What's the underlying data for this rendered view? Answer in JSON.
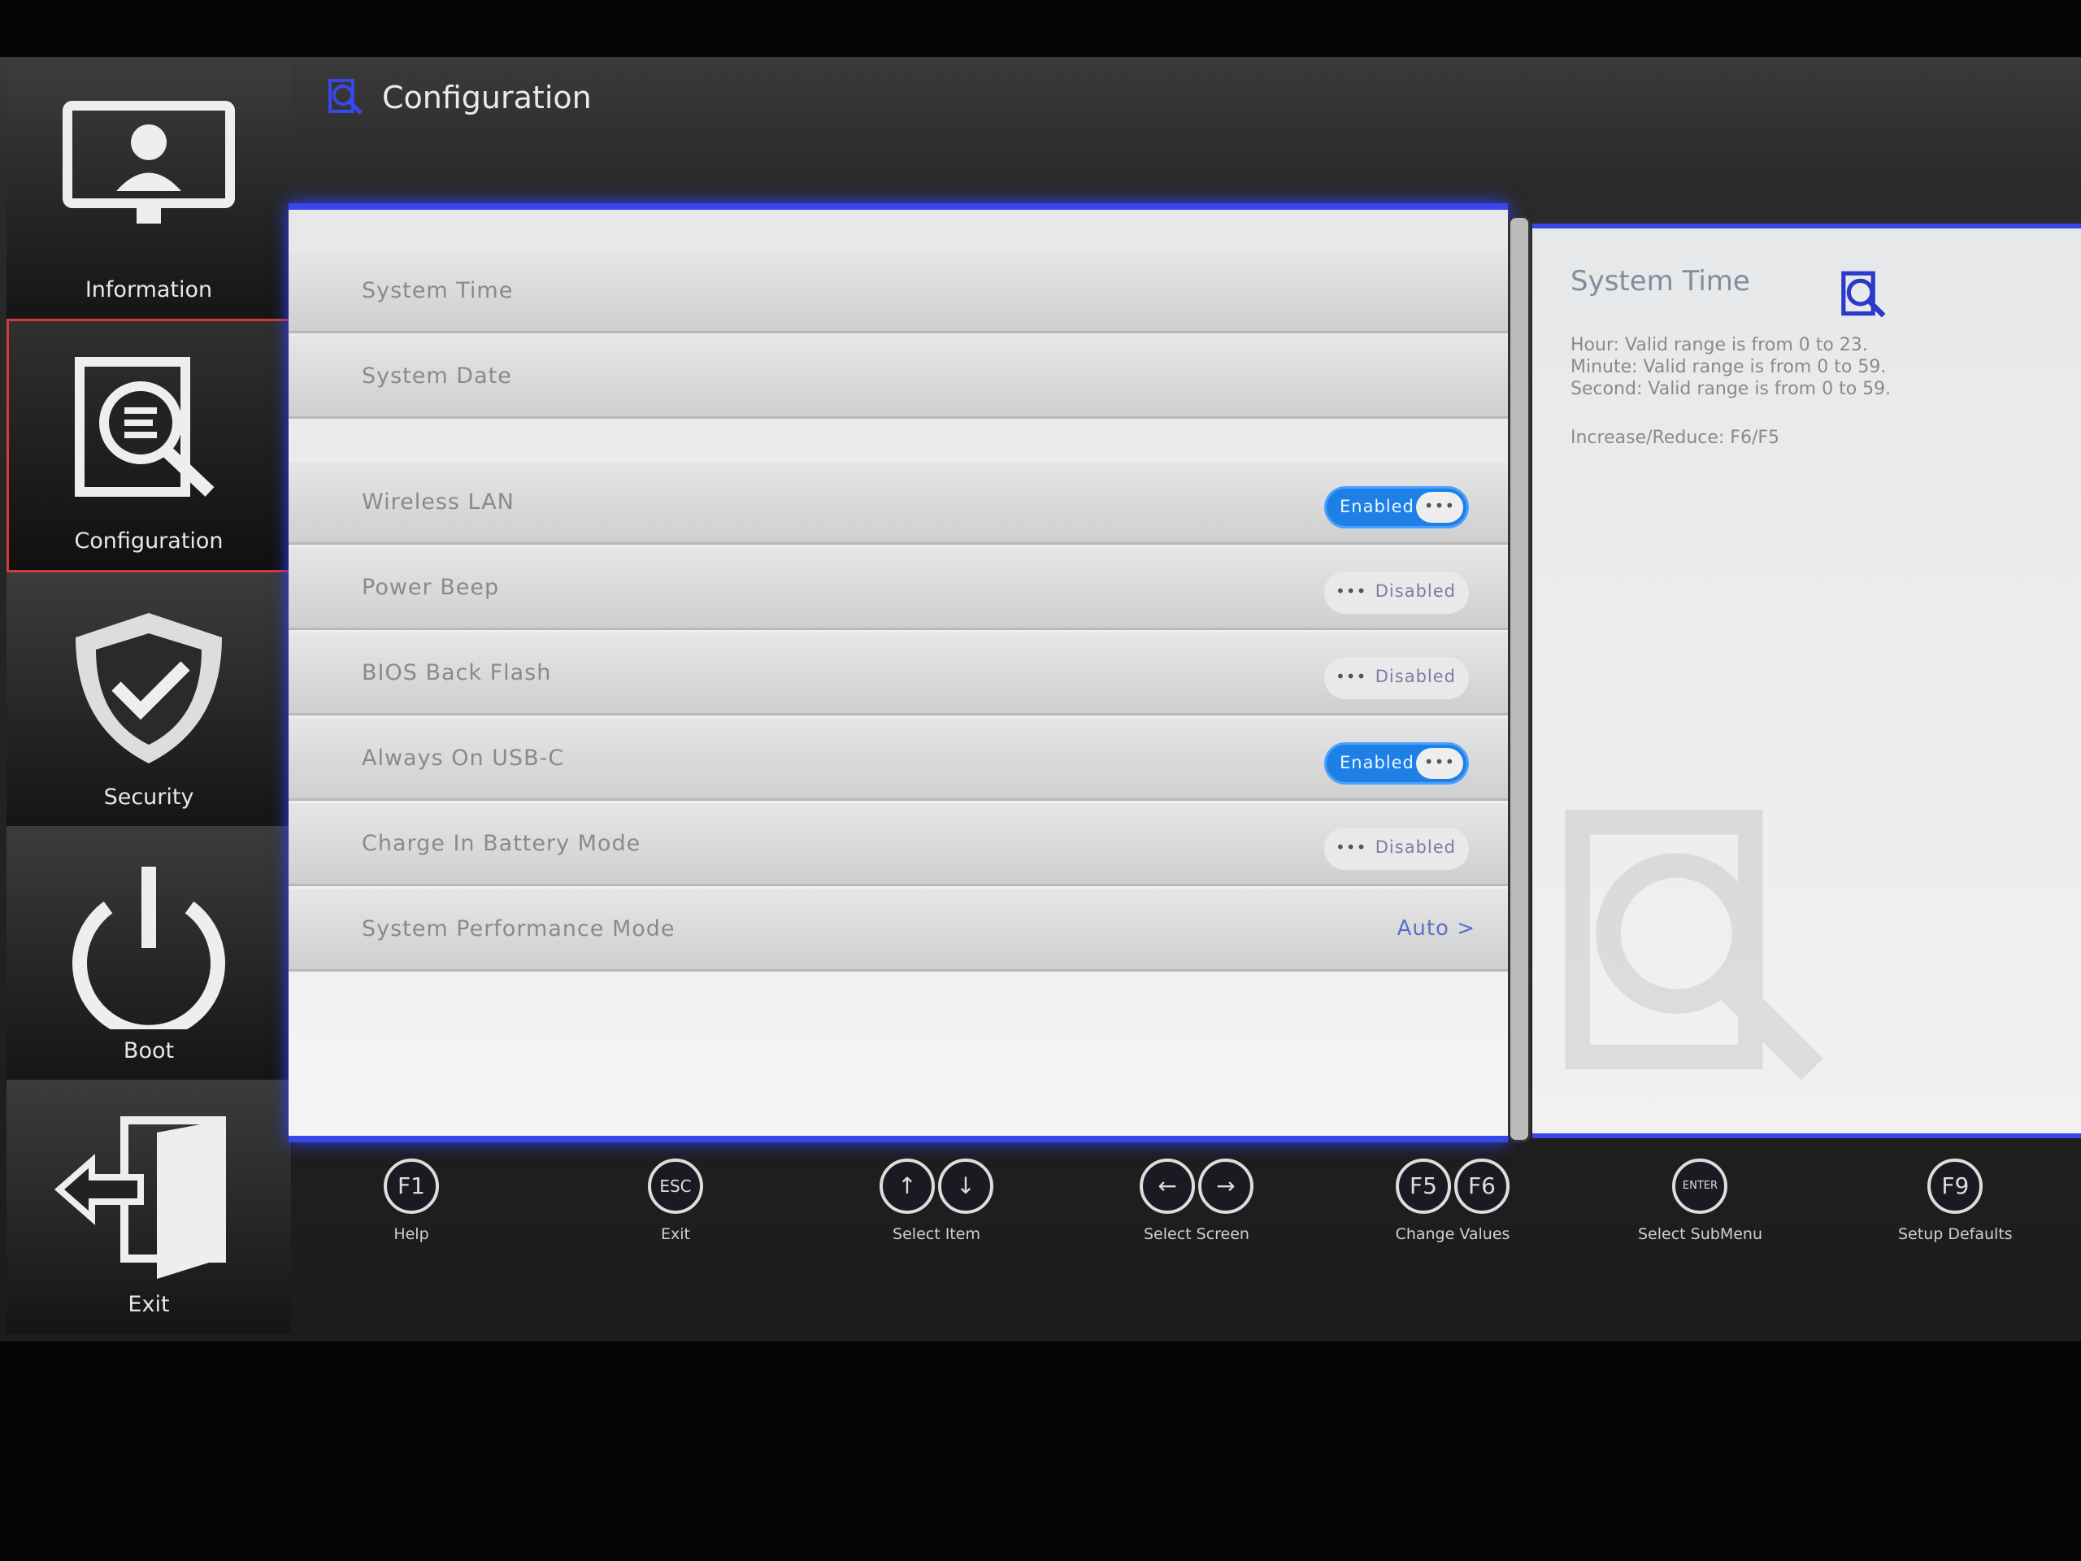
{
  "sidebar": {
    "items": [
      {
        "label": "Information",
        "icon": "monitor-user-icon"
      },
      {
        "label": "Configuration",
        "icon": "document-search-icon",
        "active": true
      },
      {
        "label": "Security",
        "icon": "shield-check-icon"
      },
      {
        "label": "Boot",
        "icon": "power-icon"
      },
      {
        "label": "Exit",
        "icon": "exit-door-icon"
      }
    ]
  },
  "header": {
    "title": "Configuration"
  },
  "settings": [
    {
      "name": "System Time"
    },
    {
      "name": "System Date"
    },
    {
      "name": "Wireless LAN",
      "value": "Enabled"
    },
    {
      "name": "Power Beep",
      "value": "Disabled"
    },
    {
      "name": "BIOS Back Flash",
      "value": "Disabled"
    },
    {
      "name": "Always On USB-C",
      "value": "Enabled"
    },
    {
      "name": "Charge In Battery Mode",
      "value": "Disabled"
    },
    {
      "name": "System Performance Mode",
      "value": "Auto >"
    }
  ],
  "toggle_knob": "•••",
  "help": {
    "title": "System Time",
    "text": "Hour: Valid range is from 0 to 23.\nMinute: Valid range is from 0 to 59.\nSecond: Valid range is from 0 to 59.",
    "keys": "Increase/Reduce: F6/F5"
  },
  "footer": [
    {
      "keys": [
        "F1"
      ],
      "label": "Help"
    },
    {
      "keys": [
        "ESC"
      ],
      "label": "Exit"
    },
    {
      "keys": [
        "↑",
        "↓"
      ],
      "label": "Select Item"
    },
    {
      "keys": [
        "←",
        "→"
      ],
      "label": "Select Screen"
    },
    {
      "keys": [
        "F5",
        "F6"
      ],
      "label": "Change Values"
    },
    {
      "keys": [
        "ENTER"
      ],
      "label": "Select  SubMenu"
    },
    {
      "keys": [
        "F9"
      ],
      "label": "Setup Defaults"
    }
  ],
  "colors": {
    "accent": "#1e7fe6",
    "frame": "#3848e8",
    "active_border": "#d43a3a"
  }
}
